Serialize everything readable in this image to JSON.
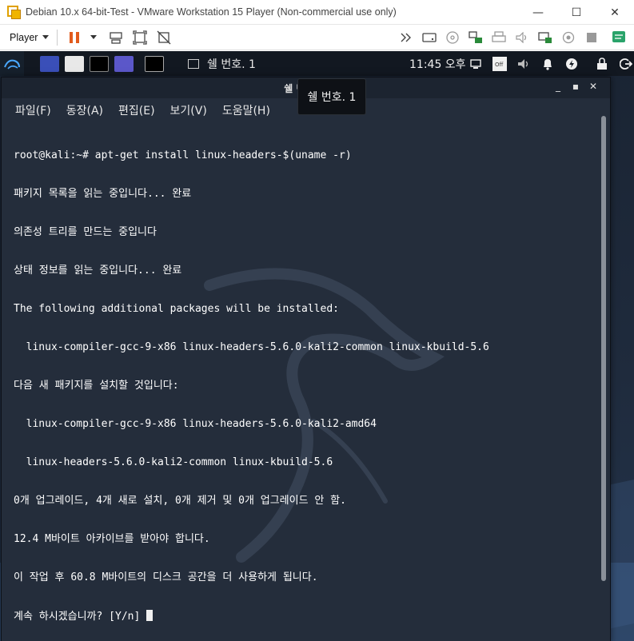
{
  "vm_window": {
    "title": "Debian 10.x 64-bit-Test - VMware Workstation 15 Player (Non-commercial use only)",
    "player_menu": "Player",
    "minimize": "—",
    "maximize": "☐",
    "close": "✕"
  },
  "kali_panel": {
    "task_label": "쉘 번호. 1",
    "clock": "11:45 오후"
  },
  "terminal": {
    "title": "쉘 번호. 1",
    "controls": [
      "_",
      "▪",
      "✕"
    ],
    "menu": [
      "파일(F)",
      "동장(A)",
      "편집(E)",
      "보기(V)",
      "도움말(H)"
    ],
    "lines": [
      "root@kali:~# apt-get install linux-headers-$(uname -r)",
      "패키지 목록을 읽는 중입니다... 완료",
      "의존성 트리를 만드는 중입니다",
      "상태 정보를 읽는 중입니다... 완료",
      "The following additional packages will be installed:",
      "  linux-compiler-gcc-9-x86 linux-headers-5.6.0-kali2-common linux-kbuild-5.6",
      "다음 새 패키지를 설치할 것입니다:",
      "  linux-compiler-gcc-9-x86 linux-headers-5.6.0-kali2-amd64",
      "  linux-headers-5.6.0-kali2-common linux-kbuild-5.6",
      "0개 업그레이드, 4개 새로 설치, 0개 제거 및 0개 업그레이드 안 함.",
      "12.4 M바이트 아카이브를 받아야 합니다.",
      "이 작업 후 60.8 M바이트의 디스크 공간을 더 사용하게 됩니다.",
      "계속 하시겠습니까? [Y/n] "
    ]
  },
  "tooltip": {
    "text": "쉘 번호. 1"
  },
  "colors": {
    "terminal_bg": "#242d3b",
    "panel_bg": "#121821",
    "text": "#ffffff"
  }
}
